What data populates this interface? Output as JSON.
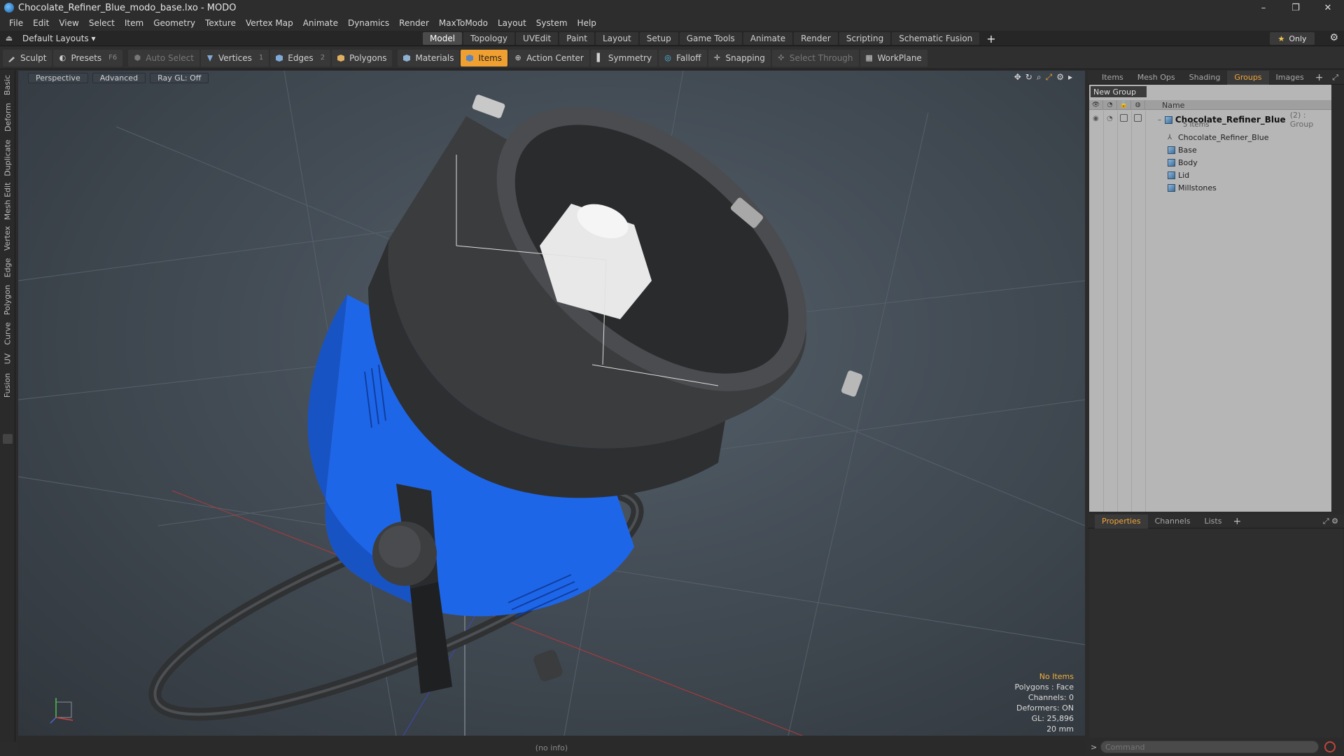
{
  "window": {
    "title": "Chocolate_Refiner_Blue_modo_base.lxo - MODO",
    "controls": [
      "–",
      "❐",
      "✕"
    ]
  },
  "menu": [
    "File",
    "Edit",
    "View",
    "Select",
    "Item",
    "Geometry",
    "Texture",
    "Vertex Map",
    "Animate",
    "Dynamics",
    "Render",
    "MaxToModo",
    "Layout",
    "System",
    "Help"
  ],
  "layoutbar": {
    "layout_select": "Default Layouts ▾",
    "tabs": [
      "Model",
      "Topology",
      "UVEdit",
      "Paint",
      "Layout",
      "Setup",
      "Game Tools",
      "Animate",
      "Render",
      "Scripting",
      "Schematic Fusion"
    ],
    "active_tab": "Model",
    "add_tab": "+",
    "only_label": "Only",
    "only_star": "★"
  },
  "toolbar": {
    "sculpt": "Sculpt",
    "presets": "Presets",
    "presets_key": "F6",
    "auto_select": "Auto Select",
    "vertices": "Vertices",
    "vertices_num": "1",
    "edges": "Edges",
    "edges_num": "2",
    "polygons": "Polygons",
    "materials": "Materials",
    "items": "Items",
    "action_center": "Action Center",
    "symmetry": "Symmetry",
    "falloff": "Falloff",
    "snapping": "Snapping",
    "select_through": "Select Through",
    "workplane": "WorkPlane"
  },
  "left_tabs": [
    "Basic",
    "Deform",
    "Duplicate",
    "Mesh Edit",
    "Vertex",
    "Edge",
    "Polygon",
    "Curve",
    "UV",
    "Fusion"
  ],
  "viewport": {
    "view_mode": "Perspective",
    "shading": "Advanced",
    "raygl": "Ray GL: Off",
    "info": {
      "no_items": "No Items",
      "polygons": "Polygons : Face",
      "channels": "Channels: 0",
      "deformers": "Deformers: ON",
      "gl": "GL: 25,896",
      "scale": "20 mm"
    }
  },
  "status": "(no info)",
  "groups_panel": {
    "tabs": [
      "Items",
      "Mesh Ops",
      "Shading",
      "Groups",
      "Images"
    ],
    "active_tab": "Groups",
    "add_tab": "+",
    "new_group": "New Group",
    "column_name": "Name",
    "group": {
      "name": "Chocolate_Refiner_Blue",
      "meta": "(2) : Group",
      "count": "5 Items"
    },
    "children": [
      {
        "name": "Chocolate_Refiner_Blue",
        "kind": "locator"
      },
      {
        "name": "Base",
        "kind": "mesh"
      },
      {
        "name": "Body",
        "kind": "mesh"
      },
      {
        "name": "Lid",
        "kind": "mesh"
      },
      {
        "name": "Millstones",
        "kind": "mesh"
      }
    ]
  },
  "properties_panel": {
    "tabs": [
      "Properties",
      "Channels",
      "Lists"
    ],
    "active_tab": "Properties",
    "add_tab": "+"
  },
  "command": {
    "prompt": ">",
    "placeholder": "Command"
  },
  "colors": {
    "accent": "#f0a030",
    "machine_blue": "#1e66e8",
    "machine_dark": "#3a3a3a"
  }
}
